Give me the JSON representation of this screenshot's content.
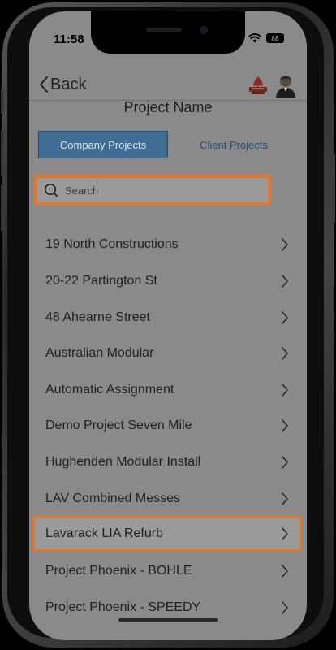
{
  "status_bar": {
    "time": "11:58",
    "battery": "88"
  },
  "nav": {
    "back_label": "Back"
  },
  "page": {
    "title": "Project Name"
  },
  "tabs": [
    {
      "label": "Company Projects",
      "selected": true
    },
    {
      "label": "Client Projects",
      "selected": false
    }
  ],
  "search": {
    "placeholder": "Search"
  },
  "projects": [
    "19 North Constructions",
    "20-22 Partington St",
    "48 Ahearne Street",
    "Australian Modular",
    "Automatic Assignment",
    "Demo Project Seven Mile",
    "Hughenden Modular Install",
    "LAV Combined Messes",
    "Lavarack LIA Refurb",
    "Project Phoenix - BOHLE",
    "Project Phoenix - SPEEDY"
  ],
  "colors": {
    "accent_highlight": "#e0772c",
    "tab_selected": "#3f6d93",
    "overlay_gray": "#8a8a8a"
  },
  "icons": {
    "back": "chevron-left-icon",
    "search": "search-icon",
    "row": "chevron-right-icon",
    "wifi": "wifi-icon",
    "battery": "battery-icon"
  }
}
